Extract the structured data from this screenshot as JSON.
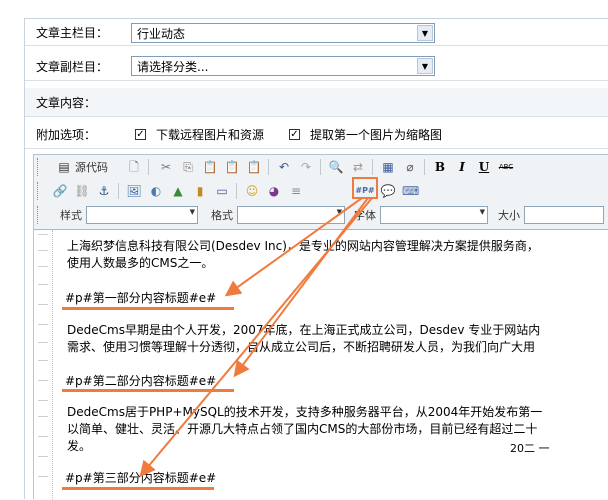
{
  "form": {
    "main_column_label": "文章主栏目：",
    "main_column_value": "行业动态",
    "sub_column_label": "文章副栏目：",
    "sub_column_value": "请选择分类...",
    "content_label": "文章内容：",
    "options_label": "附加选项：",
    "option_download": "下载远程图片和资源",
    "option_thumbnail": "提取第一个图片为缩略图"
  },
  "toolbar": {
    "source_label": "源代码",
    "style_label": "样式",
    "format_label": "格式",
    "font_label": "字体",
    "size_label": "大小",
    "bold": "B",
    "italic": "I",
    "underline": "U",
    "strike": "ABC",
    "pagebreak": "#P#"
  },
  "content": {
    "p1_line1": "上海织梦信息科技有限公司(Desdev Inc)，是专业的网站内容管理解决方案提供服务商，",
    "p1_line2": "使用人数最多的CMS之一。",
    "title1": "#p#第一部分内容标题#e#",
    "p2_line1": "DedeCms早期是由个人开发，2007年底，在上海正式成立公司，Desdev 专业于网站内",
    "p2_line2": "需求、使用习惯等理解十分透彻，自从成立公司后，不断招聘研发人员，为我们向广大用",
    "title2": "#p#第二部分内容标题#e#",
    "p3_line1": "DedeCms居于PHP+MySQL的技术开发，支持多种服务器平台，从2004年开始发布第一",
    "p3_line2": "以简单、健壮、灵活、开源几大特点占领了国内CMS的大部份市场，目前已经有超过二十",
    "p3_line3": "发。",
    "p3_tail": "20二 一",
    "title3": "#p#第三部分内容标题#e#"
  },
  "colors": {
    "annotation": "#f07b3f",
    "toolbar_bg": "#f0f3f6"
  }
}
